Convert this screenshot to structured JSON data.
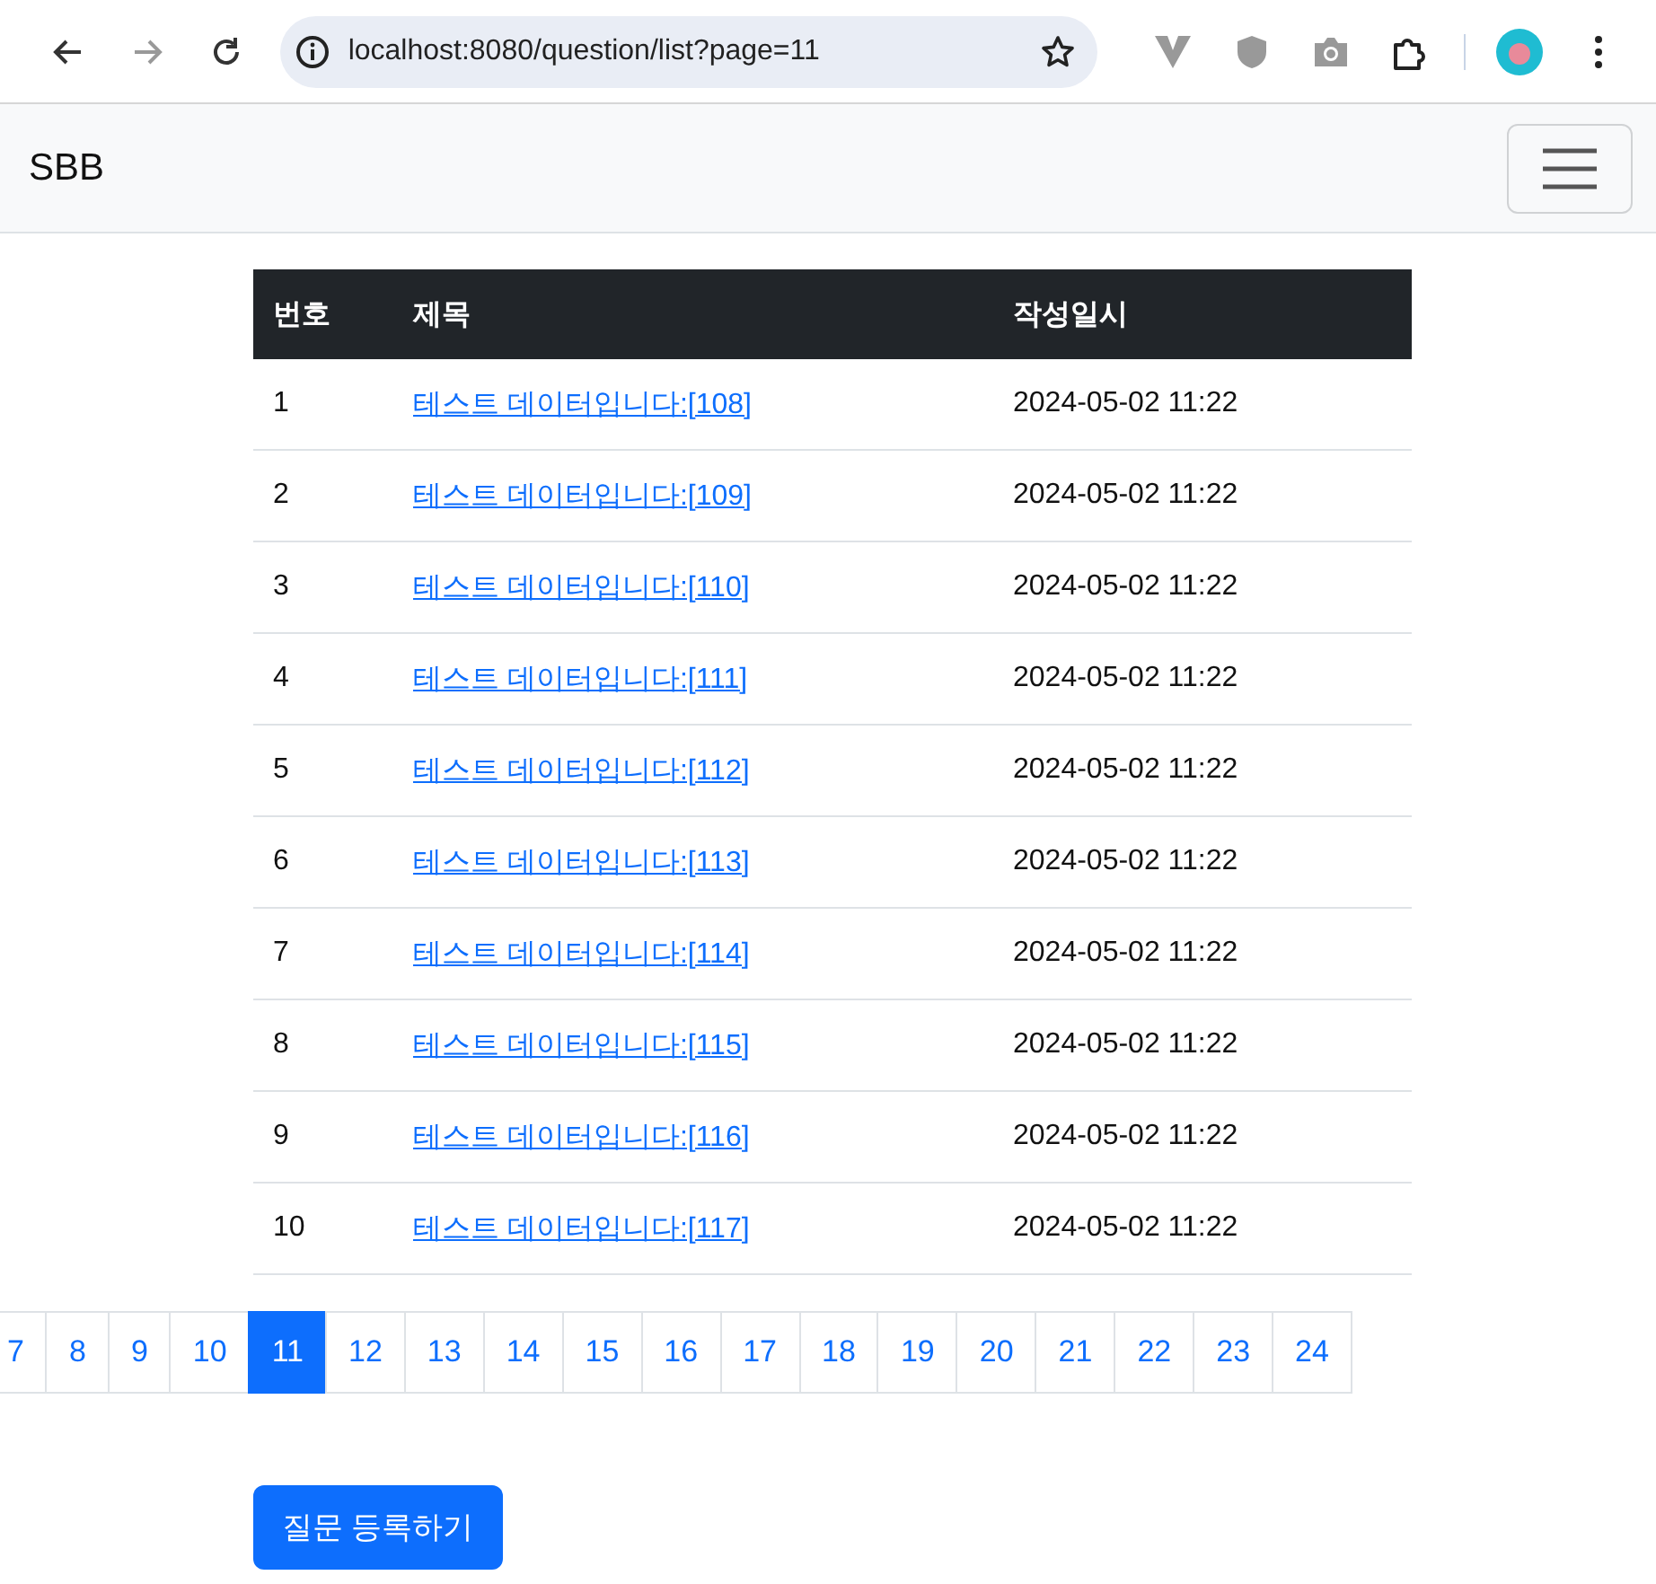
{
  "browser": {
    "url": "localhost:8080/question/list?page=11"
  },
  "navbar": {
    "brand": "SBB"
  },
  "table": {
    "columns": [
      "번호",
      "제목",
      "작성일시"
    ],
    "rows": [
      {
        "number": "1",
        "title": "테스트 데이터입니다:[108]",
        "date": "2024-05-02 11:22"
      },
      {
        "number": "2",
        "title": "테스트 데이터입니다:[109]",
        "date": "2024-05-02 11:22"
      },
      {
        "number": "3",
        "title": "테스트 데이터입니다:[110]",
        "date": "2024-05-02 11:22"
      },
      {
        "number": "4",
        "title": "테스트 데이터입니다:[111]",
        "date": "2024-05-02 11:22"
      },
      {
        "number": "5",
        "title": "테스트 데이터입니다:[112]",
        "date": "2024-05-02 11:22"
      },
      {
        "number": "6",
        "title": "테스트 데이터입니다:[113]",
        "date": "2024-05-02 11:22"
      },
      {
        "number": "7",
        "title": "테스트 데이터입니다:[114]",
        "date": "2024-05-02 11:22"
      },
      {
        "number": "8",
        "title": "테스트 데이터입니다:[115]",
        "date": "2024-05-02 11:22"
      },
      {
        "number": "9",
        "title": "테스트 데이터입니다:[116]",
        "date": "2024-05-02 11:22"
      },
      {
        "number": "10",
        "title": "테스트 데이터입니다:[117]",
        "date": "2024-05-02 11:22"
      }
    ]
  },
  "pagination": [
    {
      "label": "7",
      "selected": false
    },
    {
      "label": "8",
      "selected": false
    },
    {
      "label": "9",
      "selected": false
    },
    {
      "label": "10",
      "selected": false
    },
    {
      "label": "11",
      "selected": true
    },
    {
      "label": "12",
      "selected": false
    },
    {
      "label": "13",
      "selected": false
    },
    {
      "label": "14",
      "selected": false
    },
    {
      "label": "15",
      "selected": false
    },
    {
      "label": "16",
      "selected": false
    },
    {
      "label": "17",
      "selected": false
    },
    {
      "label": "18",
      "selected": false
    },
    {
      "label": "19",
      "selected": false
    },
    {
      "label": "20",
      "selected": false
    },
    {
      "label": "21",
      "selected": false
    },
    {
      "label": "22",
      "selected": false
    },
    {
      "label": "23",
      "selected": false
    },
    {
      "label": "24",
      "selected": false
    }
  ],
  "button": "질문 등록하기"
}
